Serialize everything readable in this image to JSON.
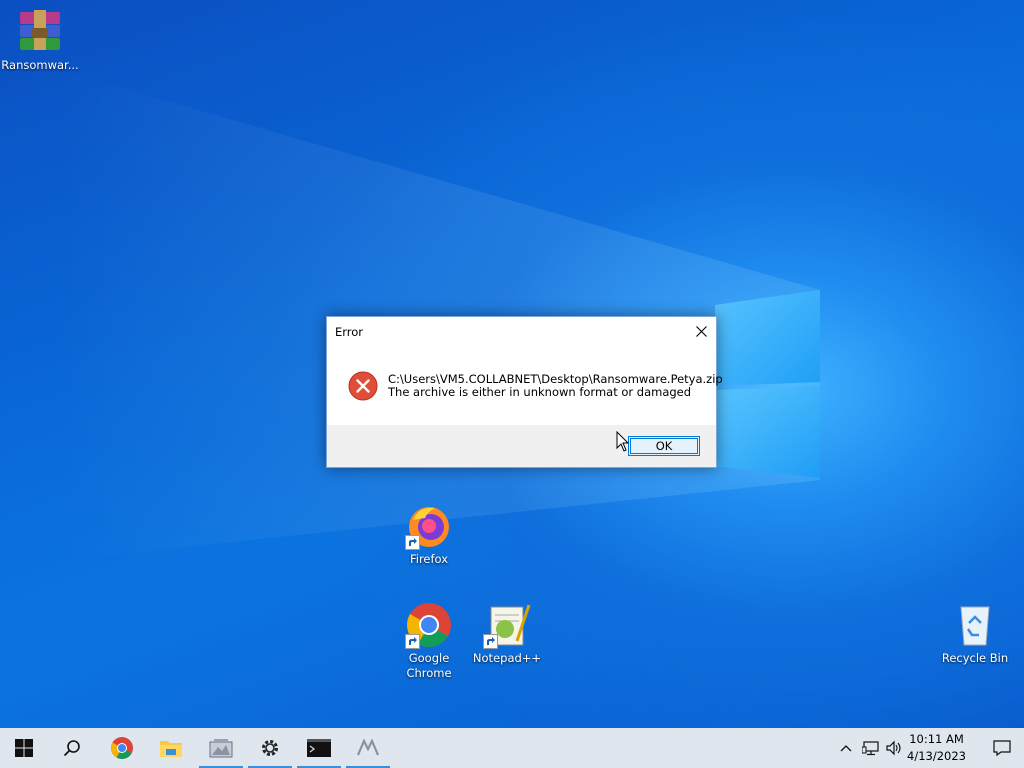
{
  "desktop": {
    "icons": {
      "ransomware": {
        "label": "Ransomwar..."
      },
      "firefox": {
        "label": "Firefox"
      },
      "chrome": {
        "label": "Google Chrome"
      },
      "notepadpp": {
        "label": "Notepad++"
      },
      "recycle": {
        "label": "Recycle Bin"
      }
    }
  },
  "dialog": {
    "title": "Error",
    "path": "C:\\Users\\VM5.COLLABNET\\Desktop\\Ransomware.Petya.zip",
    "message": "The archive is either in unknown format or damaged",
    "ok_label": "OK",
    "icon": "error-icon"
  },
  "taskbar": {
    "items": [
      "start-icon",
      "search-icon",
      "chrome-icon",
      "file-explorer-icon",
      "winrar-icon",
      "settings-icon",
      "terminal-icon",
      "app-icon"
    ],
    "clock": {
      "time": "10:11 AM",
      "date": "4/13/2023"
    }
  },
  "colors": {
    "accent": "#0078d7",
    "error": "#e04e39",
    "taskbar": "#dfe6ee"
  }
}
